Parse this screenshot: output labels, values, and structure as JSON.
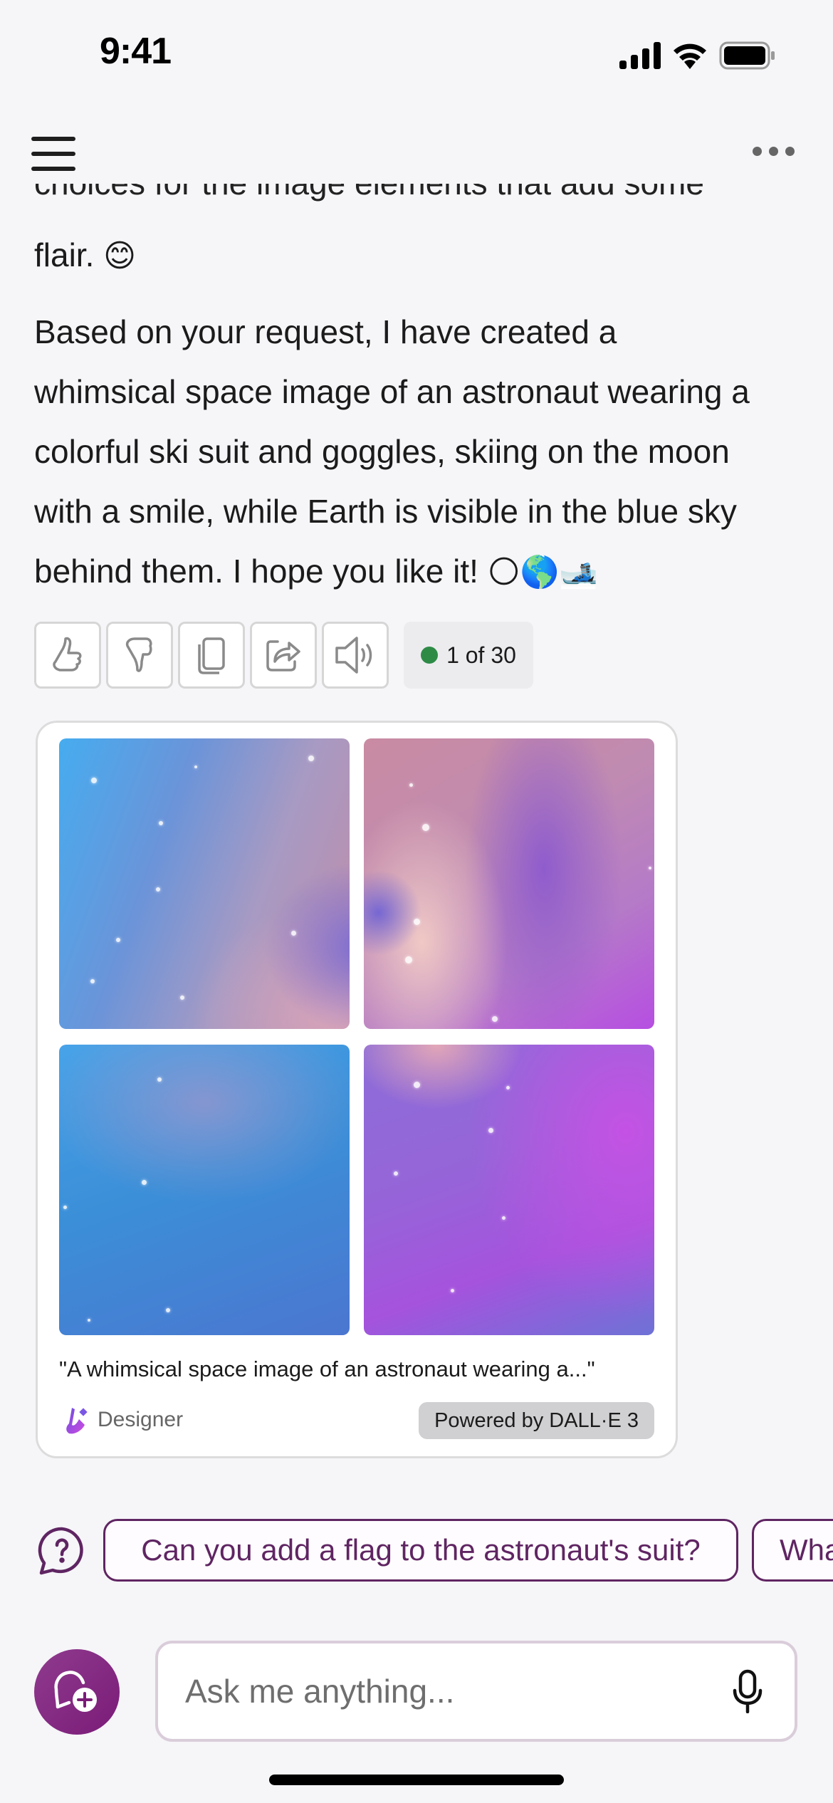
{
  "status_bar": {
    "time": "9:41",
    "icons": [
      "cellular-signal-icon",
      "wifi-icon",
      "battery-icon"
    ]
  },
  "nav": {
    "menu_icon": "hamburger-menu-icon",
    "more_icon": "more-options-icon"
  },
  "conversation": {
    "partial_line": "choices for the image elements that add some",
    "flair_line": "flair.",
    "flair_emoji": "😊",
    "response_lines": [
      "Based on your request, I have created a",
      "whimsical space image of an astronaut wearing a",
      "colorful ski suit and goggles, skiing on the moon",
      "with a smile, while Earth is visible in the blue sky",
      "behind them. I hope you like it!"
    ],
    "response_emojis": [
      "🌕",
      "🌎",
      "🎿"
    ]
  },
  "actions": {
    "buttons": [
      {
        "name": "thumbs-up",
        "icon": "thumbs-up-icon"
      },
      {
        "name": "thumbs-down",
        "icon": "thumbs-down-icon"
      },
      {
        "name": "copy",
        "icon": "copy-icon"
      },
      {
        "name": "share",
        "icon": "share-icon"
      },
      {
        "name": "read-aloud",
        "icon": "speaker-icon"
      }
    ],
    "counter": "1 of 30",
    "counter_dot_color": "#2e8b46"
  },
  "image_card": {
    "image_count": 4,
    "caption": "\"A whimsical space image of an astronaut wearing a...\"",
    "designer_label": "Designer",
    "powered_by": "Powered by DALL·E 3"
  },
  "suggestions": {
    "icon": "question-bubble-icon",
    "chips": [
      "Can you add a flag to the astronaut's suit?",
      "Wha"
    ]
  },
  "composer": {
    "new_chat_icon": "new-chat-icon",
    "placeholder": "Ask me anything...",
    "value": "",
    "mic_icon": "microphone-icon"
  },
  "colors": {
    "accent": "#5f2562",
    "new_chat_bg": "#7a1b78",
    "background": "#f6f5f8"
  }
}
